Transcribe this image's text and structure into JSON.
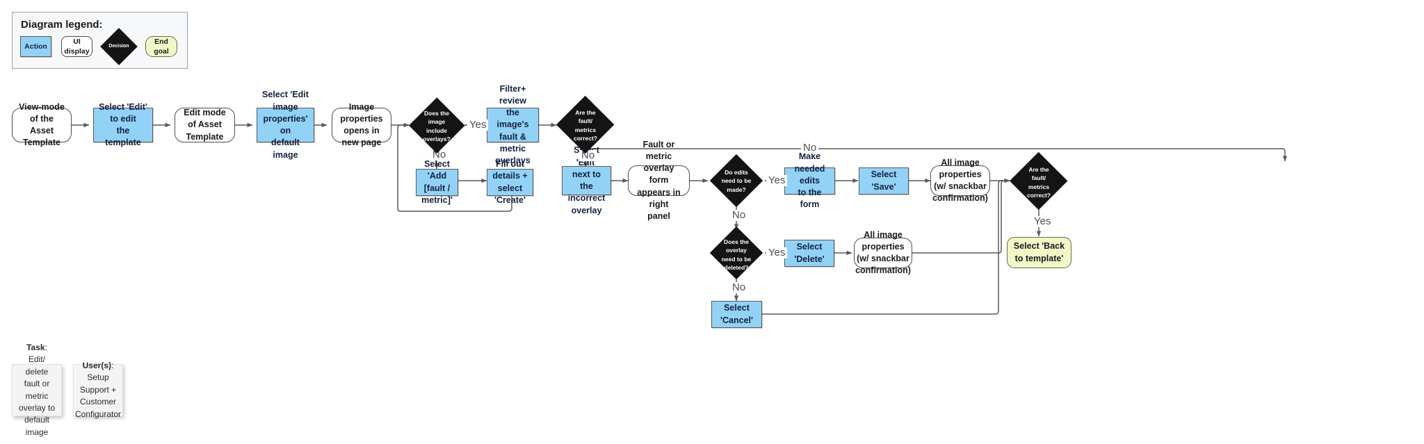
{
  "legend": {
    "title": "Diagram legend:",
    "items": [
      {
        "label": "Action",
        "type": "action"
      },
      {
        "label": "UI display",
        "type": "ui"
      },
      {
        "label": "Decision",
        "type": "decision"
      },
      {
        "label": "End goal",
        "type": "end"
      }
    ]
  },
  "nodes": {
    "view_mode": "View-mode of the\nAsset Template",
    "select_edit_template": "Select 'Edit' to edit\nthe template",
    "edit_mode": "Edit mode of Asset\nTemplate",
    "select_edit_image_props": "Select 'Edit image\nproperties' on\ndefault image",
    "image_props_new_page": "Image properties\nopens in new page",
    "decision_include_overlays": "Does the\nimage\ninclude\noverlays?",
    "filter_review": "Filter+ review the\nimage's fault &\nmetric overlays",
    "decision_fault_metrics_correct_1": "Are the\nfault/\nmetrics\ncorrect?",
    "select_add": "Select 'Add\n[fault / metric]'",
    "fill_out_details": "Fill out details +\nselect 'Create'",
    "select_edit_overlay": "Select 'Edit' next to\nthe incorrect\noverlay",
    "overlay_form_panel": "Fault or metric overlay\nform appears in right\npanel",
    "decision_edits_needed": "Do edits\nneed to be\nmade?",
    "make_edits": "Make needed edits\nto the form",
    "select_save": "Select 'Save'",
    "all_image_props_1": "All image properties\n(w/ snackbar\nconfirmation)",
    "decision_fault_metrics_correct_2": "Are the\nfault/\nmetrics\ncorrect?",
    "decision_overlay_delete": "Does the\noverlay\nneed to be\ndeleted?",
    "select_delete": "Select 'Delete'",
    "all_image_props_2": "All image properties\n(w/ snackbar\nconfirmation)",
    "select_cancel": "Select 'Cancel'",
    "select_back_to_template": "Select 'Back to template'"
  },
  "edge_labels": {
    "overlays_yes": "Yes",
    "overlays_no": "No",
    "correct1_no_down": "No",
    "correct1_no_right": "No",
    "edits_yes": "Yes",
    "edits_no": "No",
    "delete_yes": "Yes",
    "delete_no": "No",
    "correct2_yes": "Yes"
  },
  "notes": {
    "task_label": "Task",
    "task_text": ": Edit/ delete fault or metric overlay to default image",
    "users_label": "User(s)",
    "users_text": ": Setup Support + Customer Configurator"
  },
  "colors": {
    "action_fill": "#93d2f7",
    "ui_fill": "#ffffff",
    "decision_fill": "#141414",
    "end_fill": "#f2f7c8",
    "legend_bg": "#f7f8fa",
    "edge_stroke": "#595959"
  }
}
